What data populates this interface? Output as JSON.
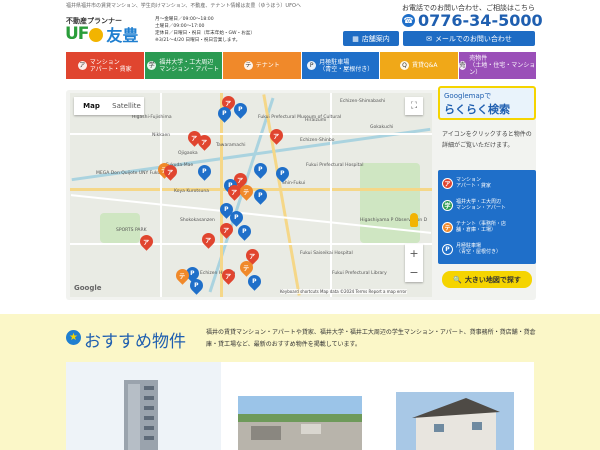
{
  "header": {
    "tagline": "福井県福井市の賃貸マンション、学生向けマンション、不動産、テナント情報は友豊（ゆうほう）UFOへ",
    "logo_small": "不動産プランナー",
    "logo_ufo": "UF",
    "logo_ufo_end": "",
    "logo_name": "友豊",
    "hours": [
      "月～金曜日／09:00～18:00",
      "土曜日／09:00～17:00",
      "定休日／日曜日・祝日（年末年始・GW・お盆）",
      "※3/21～4/20 日曜日・祝日営業します。"
    ],
    "contact_text": "お電話でのお問い合わせ、ご相談はこちら",
    "phone": "0776-34-5000",
    "store_btn": "店舗案内",
    "mail_btn": "メールでのお問い合わせ"
  },
  "nav": [
    {
      "label1": "マンション",
      "label2": "アパート・賃家",
      "color": "#e0452f",
      "icon": "ア"
    },
    {
      "label1": "福井大学・工大周辺",
      "label2": "マンション・アパート",
      "color": "#2b9a52",
      "icon": "学"
    },
    {
      "label1": "テナント",
      "label2": "",
      "color": "#f0892a",
      "icon": "テ"
    },
    {
      "label1": "月極駐車場",
      "label2": "（青空・屋根付き）",
      "color": "#1f6fc9",
      "icon": "P"
    },
    {
      "label1": "賃貸Q&A",
      "label2": "",
      "color": "#f0a818",
      "icon": "Q"
    },
    {
      "label1": "売物件",
      "label2": "（土地・住宅・マンション）",
      "color": "#9a4fb8",
      "icon": "売"
    }
  ],
  "map": {
    "tab_map": "Map",
    "tab_satellite": "Satellite",
    "labels": [
      "Echizen-Shimabashi",
      "Fukui Prefectural Museum of Cultural",
      "Higashi-Fujishima",
      "Nikkaen",
      "Tawaramachi",
      "Ojigaoka",
      "Echizen-Shinbo",
      "Hiraizumi",
      "Gokakuchi",
      "Fukuda-Mae",
      "MEGA Don Quijote UNY Fukui",
      "Koya Kurotsuna",
      "Shin-Fukui",
      "Fukui Prefectural Hospital",
      "SPORTS PARK",
      "Shokokasanzen",
      "Higashiyama P Observation D",
      "Fukui Saiseikai Hospital",
      "Fukui Prefectural Library",
      "Echizen Harada"
    ],
    "footer": "Keyboard shortcuts   Map data ©2024   Terms   Report a map error",
    "google": "Google"
  },
  "side": {
    "g_line1": "Googlemapで",
    "g_line2": "らくらく検索",
    "desc": "アイコンをクリックすると物件の詳細がご覧いただけます。",
    "legend": [
      {
        "icon": "ア",
        "text1": "マンション",
        "text2": "アパート・貸家",
        "color": "#e0452f"
      },
      {
        "icon": "学",
        "text1": "福井大学・工大周辺",
        "text2": "マンション・アパート",
        "color": "#2b9a52"
      },
      {
        "icon": "テ",
        "text1": "テナント（事務所・店",
        "text2": "舗・倉庫・工場）",
        "color": "#f0892a"
      },
      {
        "icon": "P",
        "text1": "月極駐車場",
        "text2": "（青空・屋根付き）",
        "color": "#1f6fc9"
      }
    ],
    "bigmap_btn": "大きい地図で探す"
  },
  "recommend": {
    "title": "おすすめ物件",
    "desc": "福井の賃貸マンション・アパートや貸家、福井大学・福井工大周辺の学生マンション・アパート、貸事務所・貸店舗・貸倉庫・貸工場など、最新のおすすめ物件を掲載しています。"
  }
}
